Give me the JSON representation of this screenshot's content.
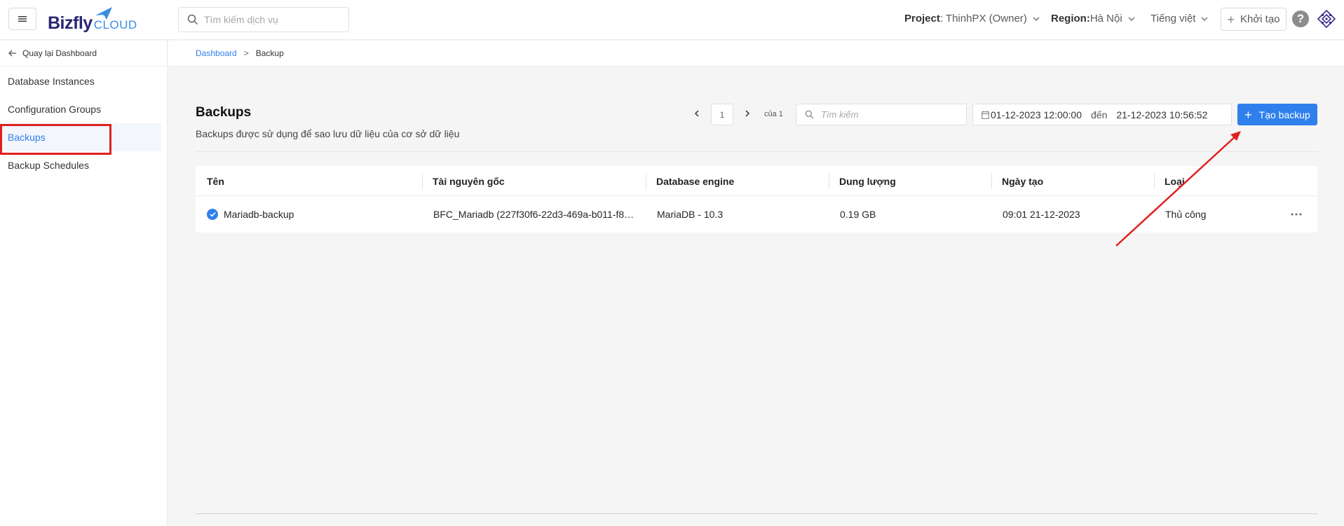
{
  "header": {
    "logo_main": "Bizfly",
    "logo_sub": "CLOUD",
    "search_placeholder": "Tìm kiếm dịch vụ",
    "project_label": "Project",
    "project_value": " : ThinhPX (Owner)",
    "region_label": "Region:",
    "region_value": " Hà Nội",
    "language": "Tiếng việt",
    "create_label": "Khởi tạo",
    "help_label": "?"
  },
  "sidebar": {
    "back_label": "Quay lại Dashboard",
    "items": [
      {
        "label": "Database Instances"
      },
      {
        "label": "Configuration Groups"
      },
      {
        "label": "Backups"
      },
      {
        "label": "Backup Schedules"
      }
    ]
  },
  "breadcrumb": {
    "root": "Dashboard",
    "separator": ">",
    "current": "Backup"
  },
  "page": {
    "title": "Backups",
    "subtitle": "Backups được sử dụng để sao lưu dữ liệu của cơ sở dữ liệu"
  },
  "toolbar": {
    "page_current": "1",
    "page_of": "của 1",
    "search_placeholder": "Tìm kiếm",
    "date_from": "01-12-2023 12:00:00",
    "date_to_label": "đến",
    "date_to": "21-12-2023 10:56:52",
    "create_backup_label": "Tạo backup"
  },
  "table": {
    "columns": [
      "Tên",
      "Tài nguyên gốc",
      "Database engine",
      "Dung lượng",
      "Ngày tạo",
      "Loại"
    ],
    "rows": [
      {
        "name": "Mariadb-backup",
        "source": "BFC_Mariadb (227f30f6-22d3-469a-b011-f8…",
        "engine": "MariaDB - 10.3",
        "size": "0.19 GB",
        "created": "09:01 21-12-2023",
        "type": "Thủ công"
      }
    ]
  },
  "colors": {
    "primary": "#2f80ed",
    "brand_dark": "#2a2674",
    "highlight_box": "#e02020",
    "annotation_arrow": "#e02020"
  }
}
